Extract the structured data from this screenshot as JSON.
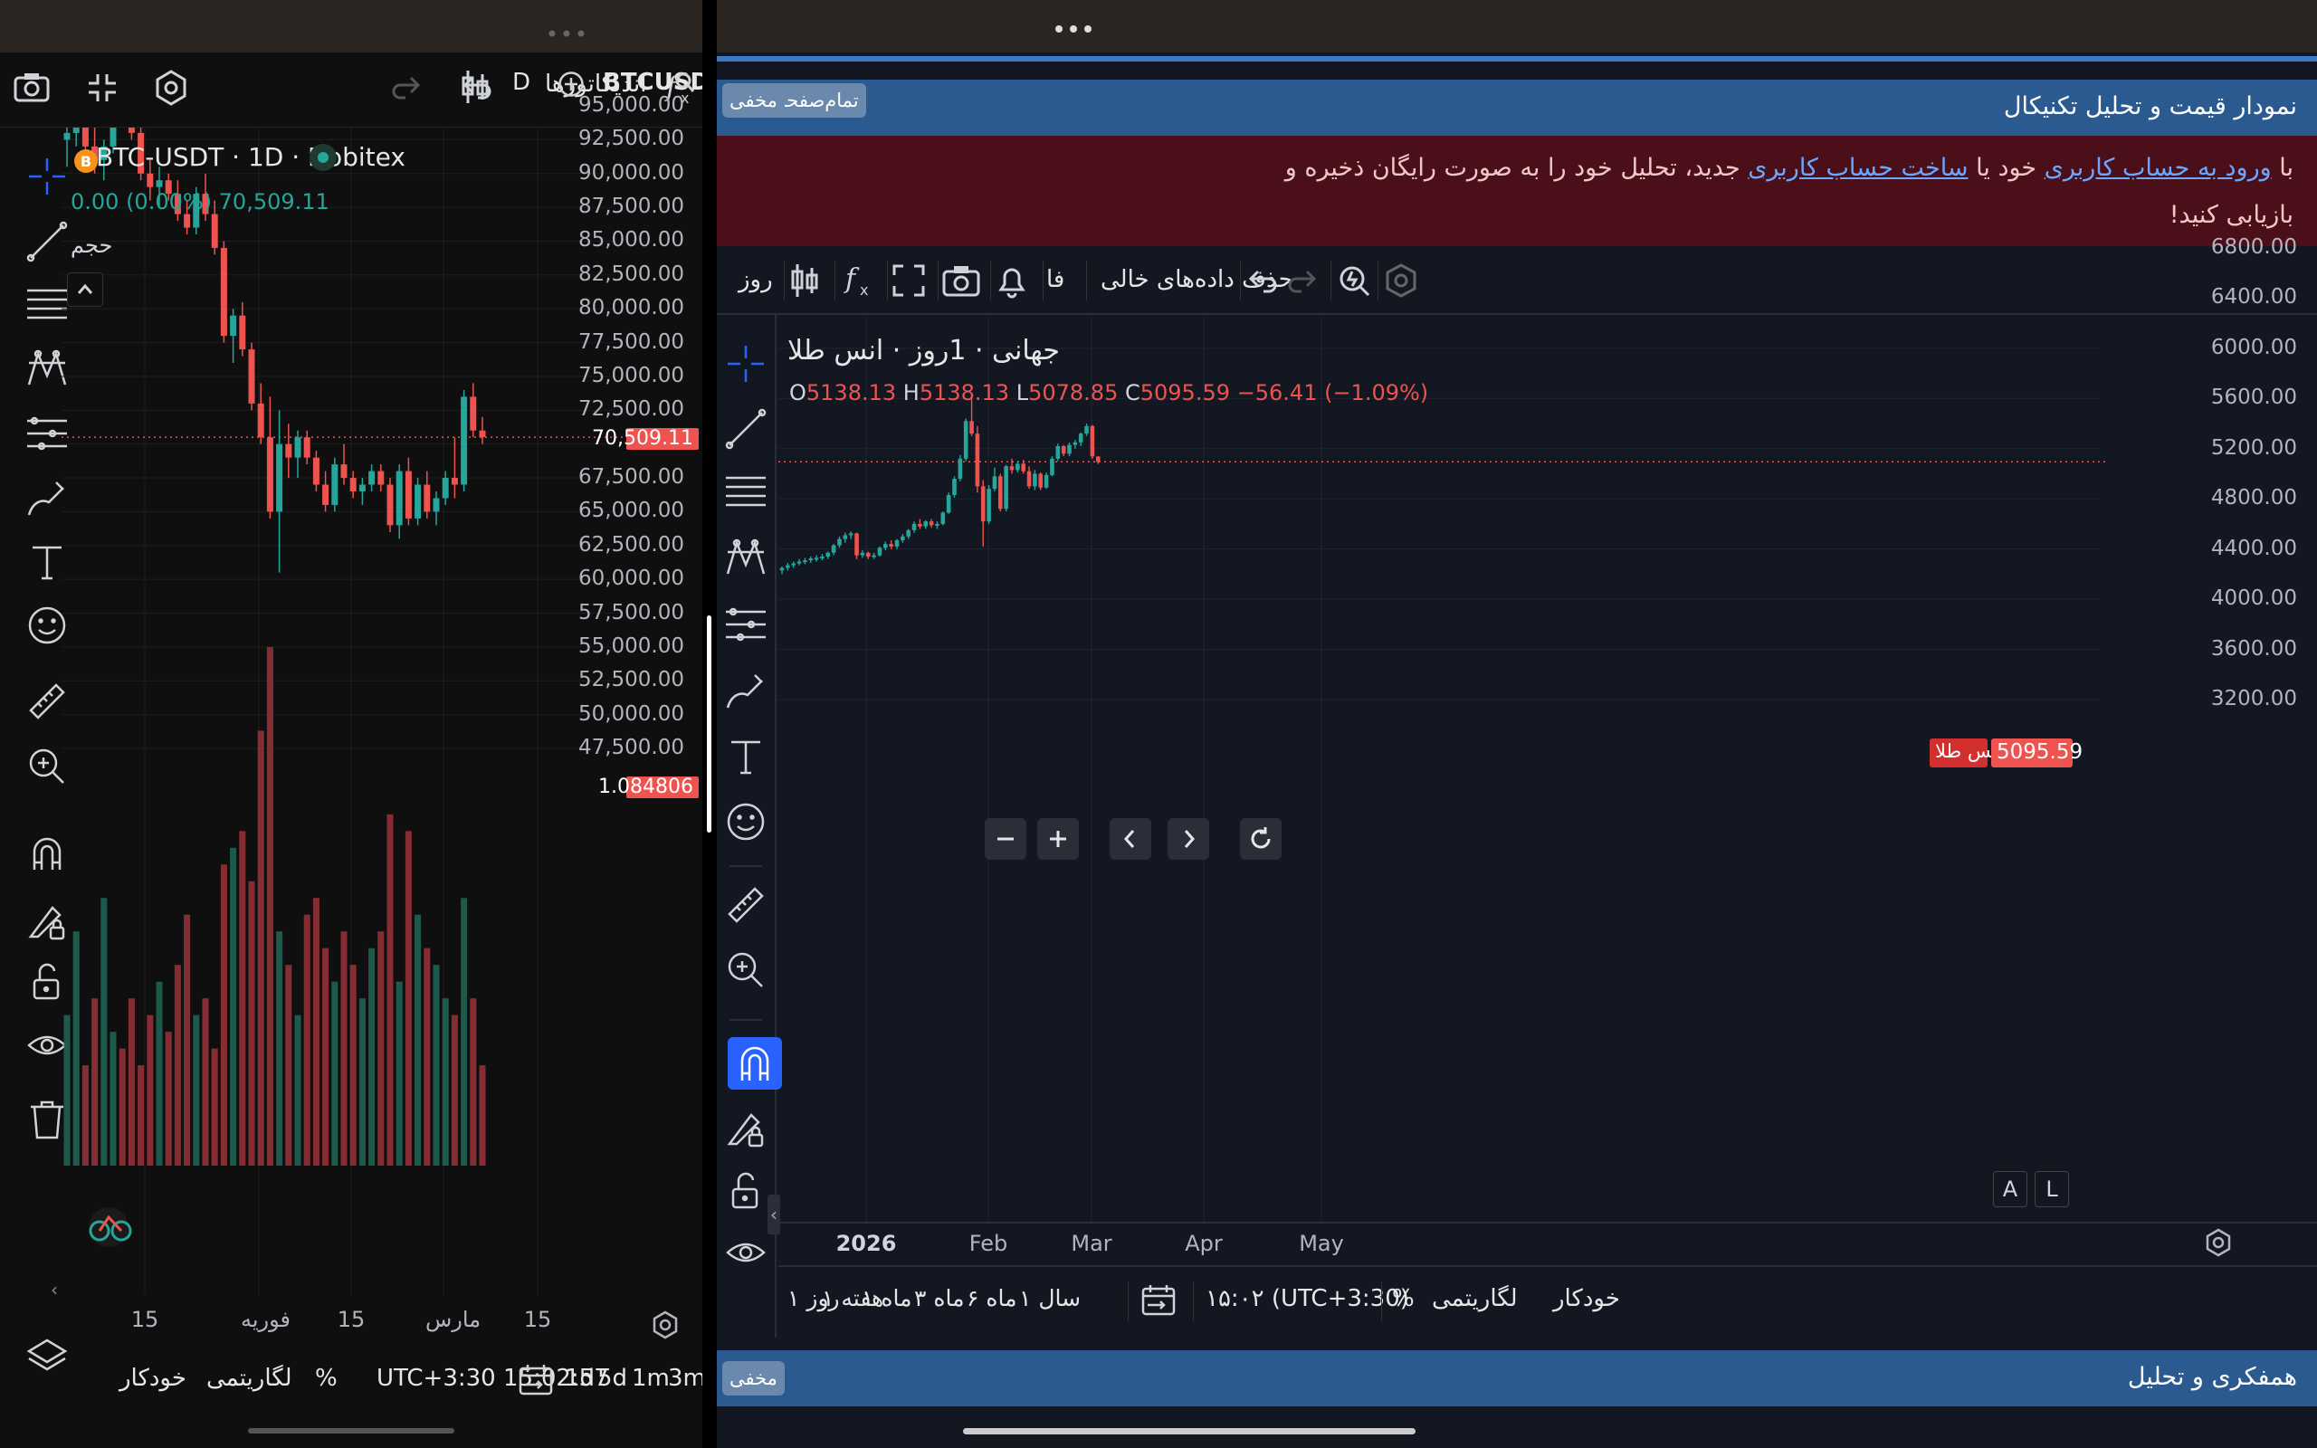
{
  "left_app": {
    "symbol": "BTCUSDT",
    "interval_button": "D",
    "indicators_label": "اندیکاتورها",
    "legend_title": "BTC-USDT · 1D · Nobitex",
    "legend_values": "0.00 (0.00%)  70,509.11",
    "volume_label": "حجم",
    "price_axis": [
      "95,000.00",
      "92,500.00",
      "90,000.00",
      "87,500.00",
      "85,000.00",
      "82,500.00",
      "80,000.00",
      "77,500.00",
      "75,000.00",
      "72,500.00",
      "67,500.00",
      "65,000.00",
      "62,500.00",
      "60,000.00",
      "57,500.00",
      "55,000.00",
      "52,500.00",
      "50,000.00",
      "47,500.00"
    ],
    "last_price_badge": "70,509.11",
    "volume_badge": "1.084806",
    "time_axis": [
      "15",
      "فوریه",
      "15",
      "مارس",
      "15"
    ],
    "bottom": {
      "auto": "خودکار",
      "log": "لگاریتمی",
      "percent": "%",
      "timezone_time": "UTC+3:30 15:02:57",
      "ranges": [
        "1d",
        "5d",
        "1m",
        "3m"
      ]
    },
    "colors": {
      "up": "#26a69a",
      "down": "#ef5350",
      "bg": "#0f0f0f"
    }
  },
  "left_chart_data": {
    "type": "candlestick",
    "title": "BTC-USDT · 1D · Nobitex",
    "ylim": [
      46000,
      97000
    ],
    "last": 70509.11,
    "candles": [
      [
        92500,
        94000,
        90500,
        93000
      ],
      [
        93000,
        95500,
        92000,
        94200
      ],
      [
        94200,
        95000,
        91500,
        92000
      ],
      [
        92000,
        93500,
        90000,
        91000
      ],
      [
        91000,
        92500,
        89500,
        92000
      ],
      [
        92000,
        96500,
        91500,
        95500
      ],
      [
        95500,
        96000,
        94000,
        94500
      ],
      [
        94500,
        95500,
        92500,
        93000
      ],
      [
        93000,
        94000,
        89500,
        90000
      ],
      [
        90000,
        91000,
        88000,
        89000
      ],
      [
        89000,
        90500,
        87500,
        89500
      ],
      [
        89500,
        90000,
        88000,
        88500
      ],
      [
        88500,
        89500,
        86500,
        87000
      ],
      [
        87000,
        88000,
        85500,
        86000
      ],
      [
        86000,
        89000,
        85500,
        88500
      ],
      [
        88500,
        90000,
        86500,
        87000
      ],
      [
        87000,
        88000,
        84000,
        84500
      ],
      [
        84500,
        85000,
        77500,
        78000
      ],
      [
        78000,
        80000,
        76000,
        79500
      ],
      [
        79500,
        80500,
        76500,
        77000
      ],
      [
        77000,
        77500,
        72500,
        73000
      ],
      [
        73000,
        74500,
        70000,
        70500
      ],
      [
        70500,
        73500,
        64500,
        65000
      ],
      [
        65000,
        72500,
        60500,
        70000
      ],
      [
        70000,
        71500,
        67500,
        69000
      ],
      [
        69000,
        71000,
        67500,
        70500
      ],
      [
        70500,
        71000,
        68500,
        69000
      ],
      [
        69000,
        69500,
        66500,
        67000
      ],
      [
        67000,
        68000,
        65000,
        65500
      ],
      [
        65500,
        69000,
        65000,
        68500
      ],
      [
        68500,
        70000,
        67000,
        67500
      ],
      [
        67500,
        68000,
        66000,
        66500
      ],
      [
        66500,
        67500,
        65500,
        67000
      ],
      [
        67000,
        68500,
        66500,
        68000
      ],
      [
        68000,
        68500,
        66500,
        67000
      ],
      [
        67000,
        67500,
        63500,
        64000
      ],
      [
        64000,
        68500,
        63000,
        68000
      ],
      [
        68000,
        69000,
        64000,
        64500
      ],
      [
        64500,
        67500,
        64000,
        67000
      ],
      [
        67000,
        68000,
        64500,
        65000
      ],
      [
        65000,
        66500,
        64000,
        66000
      ],
      [
        66000,
        68000,
        65500,
        67500
      ],
      [
        67500,
        70500,
        66000,
        67000
      ],
      [
        67000,
        74000,
        66500,
        73500
      ],
      [
        73500,
        74500,
        70500,
        71000
      ],
      [
        71000,
        72000,
        70000,
        70509
      ]
    ],
    "volume_ylim": [
      0,
      1.65
    ],
    "volumes": [
      0.45,
      0.7,
      0.3,
      0.5,
      0.8,
      0.4,
      0.35,
      0.5,
      0.3,
      0.45,
      0.55,
      0.4,
      0.6,
      0.75,
      0.45,
      0.5,
      0.35,
      0.9,
      0.95,
      1.0,
      0.85,
      1.3,
      1.55,
      0.7,
      0.6,
      0.45,
      0.75,
      0.8,
      0.65,
      0.55,
      0.7,
      0.6,
      0.5,
      0.65,
      0.7,
      1.05,
      0.55,
      1.0,
      0.75,
      0.65,
      0.6,
      0.5,
      0.45,
      0.8,
      0.5,
      0.3
    ]
  },
  "right_app": {
    "page_title": "نمودار قیمت و تحلیل تکنیکال",
    "btn_fullscreen": "تمام‌صفحه",
    "btn_hide": "مخفی",
    "notice_pre": "با ",
    "notice_link1": "ورود به حساب کاربری",
    "notice_mid": " خود یا ",
    "notice_link2": "ساخت حساب کاربری",
    "notice_post": " جدید، تحلیل خود را به صورت رایگان ذخیره و بازیابی کنید!",
    "toolbar": {
      "interval": "روز",
      "lang": "فا",
      "remove_empty": "حذف داده‌های خالی"
    },
    "legend_title": "جهانی · 1روز · انس طلا",
    "ohlc": {
      "o_label": "O",
      "o": "5138.13",
      "h_label": "H",
      "h": "5138.13",
      "l_label": "L",
      "l": "5078.85",
      "c_label": "C",
      "c": "5095.59",
      "change": "−56.41 (−1.09%)"
    },
    "price_axis": [
      "6800.00",
      "6400.00",
      "6000.00",
      "5600.00",
      "5200.00",
      "4800.00",
      "4400.00",
      "4000.00",
      "3600.00",
      "3200.00"
    ],
    "last_badge_name": "انس طلا",
    "last_badge_price": "5095.59",
    "time_axis": [
      "2026",
      "Feb",
      "Mar",
      "Apr",
      "May"
    ],
    "axis_buttons": {
      "a": "A",
      "l": "L"
    },
    "bottom": {
      "auto": "خودکار",
      "log": "لگاریتمی",
      "percent": "%",
      "time": "۱۵:۰۲ (UTC+3:30)",
      "ranges": [
        "سال ۱",
        "ماه ۶",
        "ماه ۳",
        "ماه ۱",
        "هفته ۱",
        "روز ۱"
      ]
    },
    "footer_title": "همفکری و تحلیل",
    "footer_hide": "مخفی",
    "colors": {
      "header_bg": "#2a5a8f",
      "notice_bg": "#4a0f18",
      "accent": "#2962ff"
    }
  },
  "right_chart_data": {
    "type": "candlestick",
    "title": "جهانی · 1روز · انس طلا",
    "ylim": [
      2950,
      7050
    ],
    "last": 5095.59,
    "x_date_ticks": [
      "2026",
      "Feb",
      "Mar",
      "Apr",
      "May"
    ],
    "candles": [
      [
        4230,
        4260,
        4200,
        4250
      ],
      [
        4250,
        4290,
        4230,
        4270
      ],
      [
        4270,
        4300,
        4250,
        4285
      ],
      [
        4285,
        4320,
        4270,
        4300
      ],
      [
        4300,
        4330,
        4280,
        4310
      ],
      [
        4310,
        4340,
        4290,
        4325
      ],
      [
        4325,
        4350,
        4300,
        4330
      ],
      [
        4330,
        4360,
        4310,
        4340
      ],
      [
        4340,
        4380,
        4320,
        4370
      ],
      [
        4370,
        4440,
        4350,
        4430
      ],
      [
        4430,
        4500,
        4410,
        4480
      ],
      [
        4480,
        4530,
        4450,
        4510
      ],
      [
        4510,
        4540,
        4480,
        4525
      ],
      [
        4525,
        4530,
        4320,
        4350
      ],
      [
        4350,
        4390,
        4330,
        4370
      ],
      [
        4370,
        4380,
        4320,
        4340
      ],
      [
        4340,
        4370,
        4320,
        4350
      ],
      [
        4350,
        4420,
        4340,
        4410
      ],
      [
        4410,
        4460,
        4390,
        4440
      ],
      [
        4440,
        4470,
        4400,
        4420
      ],
      [
        4420,
        4480,
        4400,
        4470
      ],
      [
        4470,
        4520,
        4450,
        4500
      ],
      [
        4500,
        4560,
        4480,
        4550
      ],
      [
        4550,
        4620,
        4530,
        4600
      ],
      [
        4600,
        4640,
        4560,
        4580
      ],
      [
        4580,
        4630,
        4560,
        4620
      ],
      [
        4620,
        4640,
        4570,
        4590
      ],
      [
        4590,
        4620,
        4560,
        4600
      ],
      [
        4600,
        4700,
        4590,
        4690
      ],
      [
        4690,
        4850,
        4680,
        4830
      ],
      [
        4830,
        4980,
        4810,
        4960
      ],
      [
        4960,
        5150,
        4940,
        5120
      ],
      [
        5120,
        5440,
        5100,
        5420
      ],
      [
        5420,
        5600,
        5300,
        5320
      ],
      [
        5320,
        5380,
        4850,
        4900
      ],
      [
        4900,
        4950,
        4420,
        4620
      ],
      [
        4620,
        4910,
        4600,
        4880
      ],
      [
        4880,
        5050,
        4860,
        4980
      ],
      [
        4980,
        5000,
        4700,
        4720
      ],
      [
        4720,
        5070,
        4700,
        5060
      ],
      [
        5060,
        5120,
        5000,
        5030
      ],
      [
        5030,
        5100,
        5010,
        5080
      ],
      [
        5080,
        5110,
        5000,
        5020
      ],
      [
        5020,
        5060,
        4880,
        4900
      ],
      [
        4900,
        5030,
        4870,
        5000
      ],
      [
        5000,
        5010,
        4870,
        4890
      ],
      [
        4890,
        5010,
        4880,
        4990
      ],
      [
        4990,
        5140,
        4980,
        5120
      ],
      [
        5120,
        5240,
        5100,
        5220
      ],
      [
        5220,
        5230,
        5140,
        5160
      ],
      [
        5160,
        5250,
        5140,
        5230
      ],
      [
        5230,
        5270,
        5200,
        5250
      ],
      [
        5250,
        5330,
        5220,
        5320
      ],
      [
        5320,
        5400,
        5300,
        5380
      ],
      [
        5380,
        5390,
        5120,
        5138
      ],
      [
        5138,
        5138,
        5078,
        5095.59
      ]
    ]
  }
}
